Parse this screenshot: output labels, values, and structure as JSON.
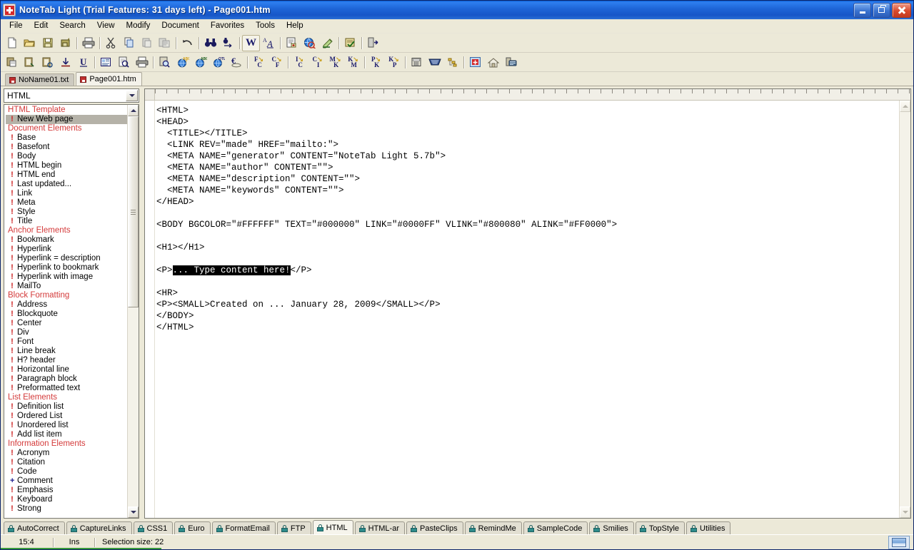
{
  "window": {
    "title": "NoteTab Light (Trial Features: 31 days left)  -  Page001.htm",
    "app_icon": "notetab-icon",
    "minimize_label": "Minimize",
    "restore_label": "Restore",
    "close_label": "Close"
  },
  "menubar": {
    "items": [
      {
        "label": "File"
      },
      {
        "label": "Edit"
      },
      {
        "label": "Search"
      },
      {
        "label": "View"
      },
      {
        "label": "Modify"
      },
      {
        "label": "Document"
      },
      {
        "label": "Favorites"
      },
      {
        "label": "Tools"
      },
      {
        "label": "Help"
      }
    ]
  },
  "toolbar_top": {
    "buttons": [
      {
        "name": "new-document-icon",
        "label": ""
      },
      {
        "name": "open-folder-icon",
        "label": ""
      },
      {
        "name": "save-icon",
        "label": ""
      },
      {
        "name": "save-all-icon",
        "label": ""
      },
      {
        "name": "separator",
        "label": ""
      },
      {
        "name": "print-icon",
        "label": ""
      },
      {
        "name": "separator",
        "label": ""
      },
      {
        "name": "cut-scissors-icon",
        "label": ""
      },
      {
        "name": "copy-icon",
        "label": ""
      },
      {
        "name": "paste-icon",
        "label": ""
      },
      {
        "name": "paste-special-icon",
        "label": ""
      },
      {
        "name": "separator",
        "label": ""
      },
      {
        "name": "undo-icon",
        "label": ""
      },
      {
        "name": "separator",
        "label": ""
      },
      {
        "name": "find-binoculars-icon",
        "label": ""
      },
      {
        "name": "replace-icon",
        "label": ""
      },
      {
        "name": "separator",
        "label": ""
      },
      {
        "name": "word-wrap-icon",
        "label": "W"
      },
      {
        "name": "change-case-icon",
        "label": "A"
      },
      {
        "name": "separator",
        "label": ""
      },
      {
        "name": "document-properties-icon",
        "label": ""
      },
      {
        "name": "web-preview-icon",
        "label": ""
      },
      {
        "name": "highlight-pen-icon",
        "label": ""
      },
      {
        "name": "separator",
        "label": ""
      },
      {
        "name": "spellcheck-icon",
        "label": ""
      },
      {
        "name": "separator",
        "label": ""
      },
      {
        "name": "exit-icon",
        "label": ""
      }
    ]
  },
  "toolbar_second": {
    "buttons": [
      {
        "name": "paste-board-icon",
        "label": ""
      },
      {
        "name": "clipboard-copy-icon",
        "label": ""
      },
      {
        "name": "clipboard-paste-icon",
        "label": ""
      },
      {
        "name": "insert-line-icon",
        "label": ""
      },
      {
        "name": "underline-icon",
        "label": "U"
      },
      {
        "name": "separator",
        "label": ""
      },
      {
        "name": "document-view-icon",
        "label": ""
      },
      {
        "name": "print-preview-icon",
        "label": ""
      },
      {
        "name": "print-2-icon",
        "label": ""
      },
      {
        "name": "separator",
        "label": ""
      },
      {
        "name": "search-document-icon",
        "label": ""
      },
      {
        "name": "globe-abc-icon",
        "label": ""
      },
      {
        "name": "globe-abc2-icon",
        "label": ""
      },
      {
        "name": "globe-otl-icon",
        "label": ""
      },
      {
        "name": "euro-converter-icon",
        "label": ""
      },
      {
        "name": "separator",
        "label": ""
      },
      {
        "name": "convert-f-to-c-icon",
        "label": "F/C"
      },
      {
        "name": "convert-c-to-f-icon",
        "label": "C/F"
      },
      {
        "name": "separator",
        "label": ""
      },
      {
        "name": "convert-i-to-c-icon",
        "label": "I/C"
      },
      {
        "name": "convert-c-to-i-icon",
        "label": "C/I"
      },
      {
        "name": "convert-m-to-k-icon",
        "label": "M/K"
      },
      {
        "name": "convert-k-to-m-icon",
        "label": "K/M"
      },
      {
        "name": "separator",
        "label": ""
      },
      {
        "name": "convert-p-to-k-icon",
        "label": "P/K"
      },
      {
        "name": "convert-k-to-p-icon",
        "label": "K/P"
      },
      {
        "name": "separator",
        "label": ""
      },
      {
        "name": "calculator-icon",
        "label": ""
      },
      {
        "name": "keyboard-icon",
        "label": ""
      },
      {
        "name": "outline-icon",
        "label": ""
      },
      {
        "name": "separator",
        "label": ""
      },
      {
        "name": "notetab-home-icon",
        "label": ""
      },
      {
        "name": "home-icon",
        "label": ""
      },
      {
        "name": "mail-icon",
        "label": ""
      }
    ]
  },
  "document_tabs": {
    "items": [
      {
        "label": "NoName01.txt",
        "active": false
      },
      {
        "label": "Page001.htm",
        "active": true
      }
    ]
  },
  "clipbook": {
    "library_selected": "HTML",
    "dropdown_icon": "chevron-down-icon",
    "scroll_up_icon": "chevron-up-icon",
    "scroll_down_icon": "chevron-down-icon",
    "entries": [
      {
        "type": "header",
        "label": "HTML Template"
      },
      {
        "type": "item",
        "label": "New Web page",
        "bullet": "!",
        "selected": true
      },
      {
        "type": "header",
        "label": "Document Elements"
      },
      {
        "type": "item",
        "label": "Base",
        "bullet": "!"
      },
      {
        "type": "item",
        "label": "Basefont",
        "bullet": "!"
      },
      {
        "type": "item",
        "label": "Body",
        "bullet": "!"
      },
      {
        "type": "item",
        "label": "HTML begin",
        "bullet": "!"
      },
      {
        "type": "item",
        "label": "HTML end",
        "bullet": "!"
      },
      {
        "type": "item",
        "label": "Last updated...",
        "bullet": "!"
      },
      {
        "type": "item",
        "label": "Link",
        "bullet": "!"
      },
      {
        "type": "item",
        "label": "Meta",
        "bullet": "!"
      },
      {
        "type": "item",
        "label": "Style",
        "bullet": "!"
      },
      {
        "type": "item",
        "label": "Title",
        "bullet": "!"
      },
      {
        "type": "header",
        "label": "Anchor Elements"
      },
      {
        "type": "item",
        "label": "Bookmark",
        "bullet": "!"
      },
      {
        "type": "item",
        "label": "Hyperlink",
        "bullet": "!"
      },
      {
        "type": "item",
        "label": "Hyperlink = description",
        "bullet": "!"
      },
      {
        "type": "item",
        "label": "Hyperlink to bookmark",
        "bullet": "!"
      },
      {
        "type": "item",
        "label": "Hyperlink with image",
        "bullet": "!"
      },
      {
        "type": "item",
        "label": "MailTo",
        "bullet": "!"
      },
      {
        "type": "header",
        "label": "Block Formatting"
      },
      {
        "type": "item",
        "label": "Address",
        "bullet": "!"
      },
      {
        "type": "item",
        "label": "Blockquote",
        "bullet": "!"
      },
      {
        "type": "item",
        "label": "Center",
        "bullet": "!"
      },
      {
        "type": "item",
        "label": "Div",
        "bullet": "!"
      },
      {
        "type": "item",
        "label": "Font",
        "bullet": "!"
      },
      {
        "type": "item",
        "label": "Line break",
        "bullet": "!"
      },
      {
        "type": "item",
        "label": "H? header",
        "bullet": "!"
      },
      {
        "type": "item",
        "label": "Horizontal line",
        "bullet": "!"
      },
      {
        "type": "item",
        "label": "Paragraph block",
        "bullet": "!"
      },
      {
        "type": "item",
        "label": "Preformatted text",
        "bullet": "!"
      },
      {
        "type": "header",
        "label": "List Elements"
      },
      {
        "type": "item",
        "label": "Definition list",
        "bullet": "!"
      },
      {
        "type": "item",
        "label": "Ordered List",
        "bullet": "!"
      },
      {
        "type": "item",
        "label": "Unordered list",
        "bullet": "!"
      },
      {
        "type": "item",
        "label": "Add list item",
        "bullet": "!"
      },
      {
        "type": "header",
        "label": "Information Elements"
      },
      {
        "type": "item",
        "label": "Acronym",
        "bullet": "!"
      },
      {
        "type": "item",
        "label": "Citation",
        "bullet": "!"
      },
      {
        "type": "item",
        "label": "Code",
        "bullet": "!"
      },
      {
        "type": "item",
        "label": "Comment",
        "bullet": "+"
      },
      {
        "type": "item",
        "label": "Emphasis",
        "bullet": "!"
      },
      {
        "type": "item",
        "label": "Keyboard",
        "bullet": "!"
      },
      {
        "type": "item",
        "label": "Strong",
        "bullet": "!"
      }
    ]
  },
  "editor": {
    "code_before_selection": "<HTML>\n<HEAD>\n  <TITLE></TITLE>\n  <LINK REV=\"made\" HREF=\"mailto:\">\n  <META NAME=\"generator\" CONTENT=\"NoteTab Light 5.7b\">\n  <META NAME=\"author\" CONTENT=\"\">\n  <META NAME=\"description\" CONTENT=\"\">\n  <META NAME=\"keywords\" CONTENT=\"\">\n</HEAD>\n\n<BODY BGCOLOR=\"#FFFFFF\" TEXT=\"#000000\" LINK=\"#0000FF\" VLINK=\"#800080\" ALINK=\"#FF0000\">\n\n<H1></H1>\n\n<P>",
    "selected_text": "... Type content here!",
    "code_after_selection": "</P>\n\n<HR>\n<P><SMALL>Created on ... January 28, 2009</SMALL></P>\n</BODY>\n</HTML>"
  },
  "clipbook_tabs": {
    "items": [
      {
        "label": "AutoCorrect",
        "active": false
      },
      {
        "label": "CaptureLinks",
        "active": false
      },
      {
        "label": "CSS1",
        "active": false
      },
      {
        "label": "Euro",
        "active": false
      },
      {
        "label": "FormatEmail",
        "active": false
      },
      {
        "label": "FTP",
        "active": false
      },
      {
        "label": "HTML",
        "active": true
      },
      {
        "label": "HTML-ar",
        "active": false
      },
      {
        "label": "PasteClips",
        "active": false
      },
      {
        "label": "RemindMe",
        "active": false
      },
      {
        "label": "SampleCode",
        "active": false
      },
      {
        "label": "Smilies",
        "active": false
      },
      {
        "label": "TopStyle",
        "active": false
      },
      {
        "label": "Utilities",
        "active": false
      }
    ]
  },
  "statusbar": {
    "cursor_position": "15:4",
    "insert_mode": "Ins",
    "selection_info": "Selection size: 22",
    "monitor_icon": "monitor-icon"
  },
  "colors": {
    "titlebar_blue": "#1e66d8",
    "clip_header_red": "#d43a3a",
    "selection_bg": "#000000",
    "list_selection_bg": "#b5b2a8",
    "face": "#ece9d8",
    "lock_teal": "#2e8b8b",
    "progress_green": "#3a9a3a"
  }
}
